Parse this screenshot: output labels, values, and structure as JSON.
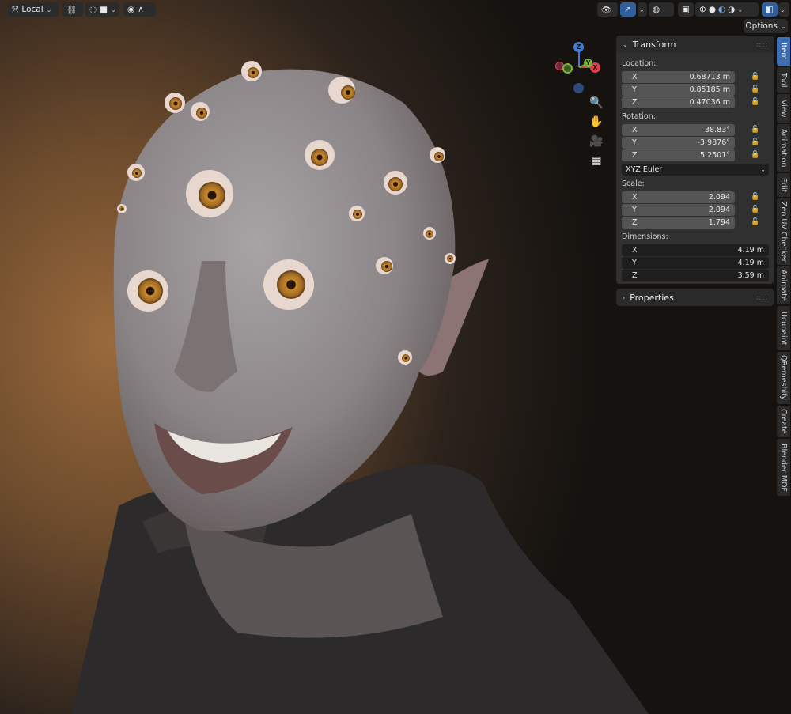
{
  "header": {
    "transform_orientation": "Local",
    "options_label": "Options"
  },
  "gizmo": {
    "x": "X",
    "y": "Y",
    "z": "Z"
  },
  "colors": {
    "accent": "#3d6db2",
    "panel": "#303030",
    "field": "#545454",
    "axis_x": "#e0404e",
    "axis_y": "#7ab83a",
    "axis_z": "#3f7bd6"
  },
  "transform_panel": {
    "title": "Transform",
    "location": {
      "label": "Location:",
      "x": "0.68713 m",
      "y": "0.85185 m",
      "z": "0.47036 m"
    },
    "rotation": {
      "label": "Rotation:",
      "x": "38.83°",
      "y": "-3.9876°",
      "z": "5.2501°",
      "mode": "XYZ Euler"
    },
    "scale": {
      "label": "Scale:",
      "x": "2.094",
      "y": "2.094",
      "z": "1.794"
    },
    "dimensions": {
      "label": "Dimensions:",
      "x": "4.19 m",
      "y": "4.19 m",
      "z": "3.59 m"
    },
    "axis_x": "X",
    "axis_y": "Y",
    "axis_z": "Z"
  },
  "properties_panel": {
    "title": "Properties"
  },
  "tabs": [
    {
      "label": "Item",
      "active": true
    },
    {
      "label": "Tool"
    },
    {
      "label": "View"
    },
    {
      "label": "Animation"
    },
    {
      "label": "Edit"
    },
    {
      "label": "Zen UV Checker"
    },
    {
      "label": "Animate"
    },
    {
      "label": "Ucupaint"
    },
    {
      "label": "QRemeshify"
    },
    {
      "label": "Create"
    },
    {
      "label": "Blender MOF"
    }
  ]
}
